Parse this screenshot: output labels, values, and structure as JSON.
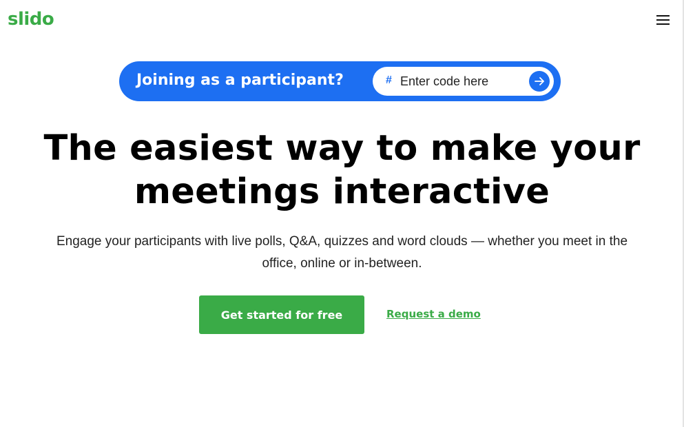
{
  "header": {
    "logo_text": "slido",
    "menu_icon": "hamburger-menu-icon"
  },
  "join": {
    "label": "Joining as a participant?",
    "hash_symbol": "#",
    "code_placeholder": "Enter code here",
    "submit_icon": "arrow-right-icon"
  },
  "hero": {
    "headline_line1": "The easiest way to make your",
    "headline_line2": "meetings interactive",
    "subtext_line1": "Engage your participants with live polls, Q&A, quizzes and word clouds — whether you meet in the",
    "subtext_line2": "office, online or in-between.",
    "cta_label": "Get started for free",
    "demo_label": "Request a demo"
  },
  "colors": {
    "brand_green": "#3aab47",
    "join_blue": "#1d6ff2",
    "text_dark": "#111111"
  }
}
